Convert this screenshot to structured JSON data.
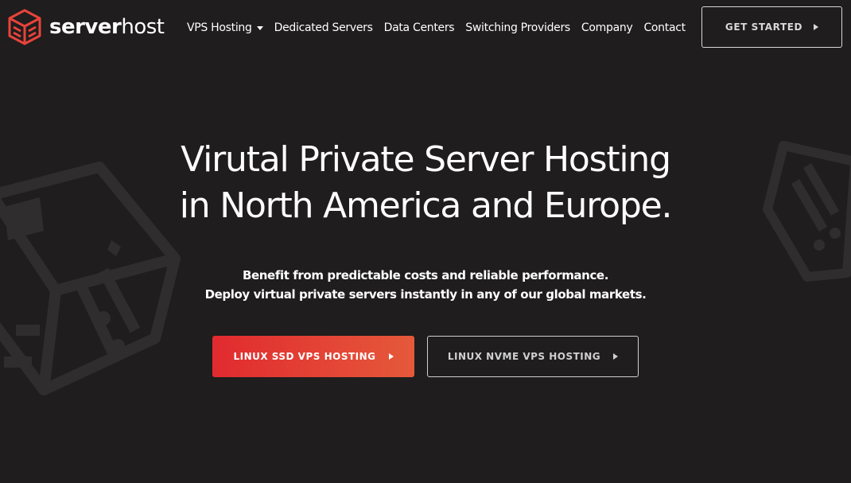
{
  "brand": {
    "name_bold": "server",
    "name_light": "host",
    "icon": "logo-cube-icon",
    "accent_color": "#e8433a"
  },
  "nav": {
    "items": [
      {
        "label": "VPS Hosting",
        "has_dropdown": true
      },
      {
        "label": "Dedicated Servers"
      },
      {
        "label": "Data Centers"
      },
      {
        "label": "Switching Providers"
      },
      {
        "label": "Company"
      },
      {
        "label": "Contact"
      }
    ],
    "cta_label": "GET STARTED"
  },
  "hero": {
    "title_line1": "Virutal Private Server Hosting",
    "title_line2": "in North America and Europe.",
    "subtitle_line1": "Benefit from predictable costs and reliable performance.",
    "subtitle_line2": "Deploy virtual private servers instantly in any of our global markets.",
    "primary_button": "LINUX SSD VPS HOSTING",
    "secondary_button": "LINUX NVME VPS HOSTING"
  },
  "colors": {
    "background": "#1f1d1d",
    "primary_gradient_start": "#e12a2f",
    "primary_gradient_end": "#e5593a",
    "decoration": "#2f2d2d"
  }
}
